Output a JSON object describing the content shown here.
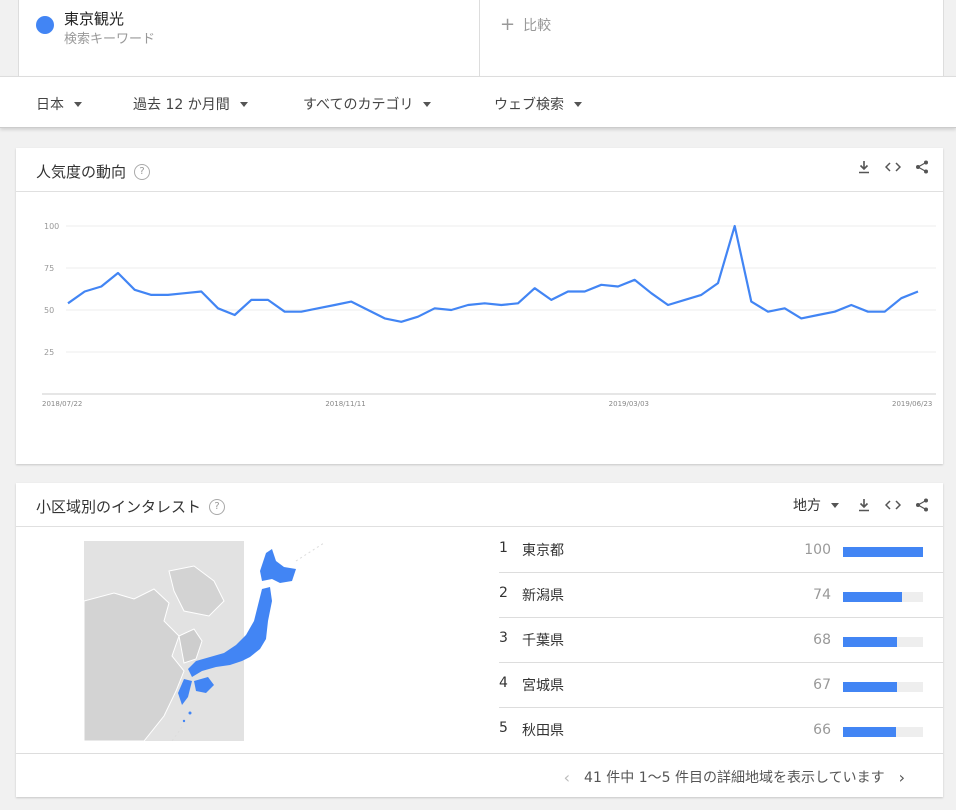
{
  "keyword": {
    "term": "東京観光",
    "type": "検索キーワード",
    "color": "#4285f4"
  },
  "compare": {
    "label": "比較",
    "icon": "plus-icon"
  },
  "filters": [
    {
      "label": "日本"
    },
    {
      "label": "過去 12 か月間"
    },
    {
      "label": "すべてのカテゴリ"
    },
    {
      "label": "ウェブ検索"
    }
  ],
  "interest_over_time": {
    "title": "人気度の動向",
    "help": "?",
    "tools": [
      "download-icon",
      "embed-icon",
      "share-icon"
    ]
  },
  "chart_data": {
    "type": "line",
    "ylim": [
      0,
      100
    ],
    "yticks": [
      25,
      50,
      75,
      100
    ],
    "xtick_labels": [
      "2018/07/22",
      "2018/11/11",
      "2019/03/03",
      "2019/06/23"
    ],
    "series": [
      {
        "color": "#4285f4",
        "values": [
          54,
          61,
          64,
          72,
          62,
          59,
          59,
          60,
          61,
          51,
          47,
          56,
          56,
          49,
          49,
          51,
          53,
          55,
          50,
          45,
          43,
          46,
          51,
          50,
          53,
          54,
          53,
          54,
          63,
          56,
          61,
          61,
          65,
          64,
          68,
          60,
          53,
          56,
          59,
          66,
          100,
          55,
          49,
          51,
          45,
          47,
          49,
          53,
          49,
          49,
          57,
          61
        ]
      }
    ]
  },
  "interest_by_region": {
    "title": "小区域別のインタレスト",
    "help": "?",
    "resolution_label": "地方",
    "tools": [
      "download-icon",
      "embed-icon",
      "share-icon"
    ],
    "rows": [
      {
        "rank": "1",
        "name": "東京都",
        "value": "100",
        "pct": 100
      },
      {
        "rank": "2",
        "name": "新潟県",
        "value": "74",
        "pct": 74
      },
      {
        "rank": "3",
        "name": "千葉県",
        "value": "68",
        "pct": 68
      },
      {
        "rank": "4",
        "name": "宮城県",
        "value": "67",
        "pct": 67
      },
      {
        "rank": "5",
        "name": "秋田県",
        "value": "66",
        "pct": 66
      }
    ],
    "pager_text": "41 件中 1～5 件目の詳細地域を表示しています"
  }
}
